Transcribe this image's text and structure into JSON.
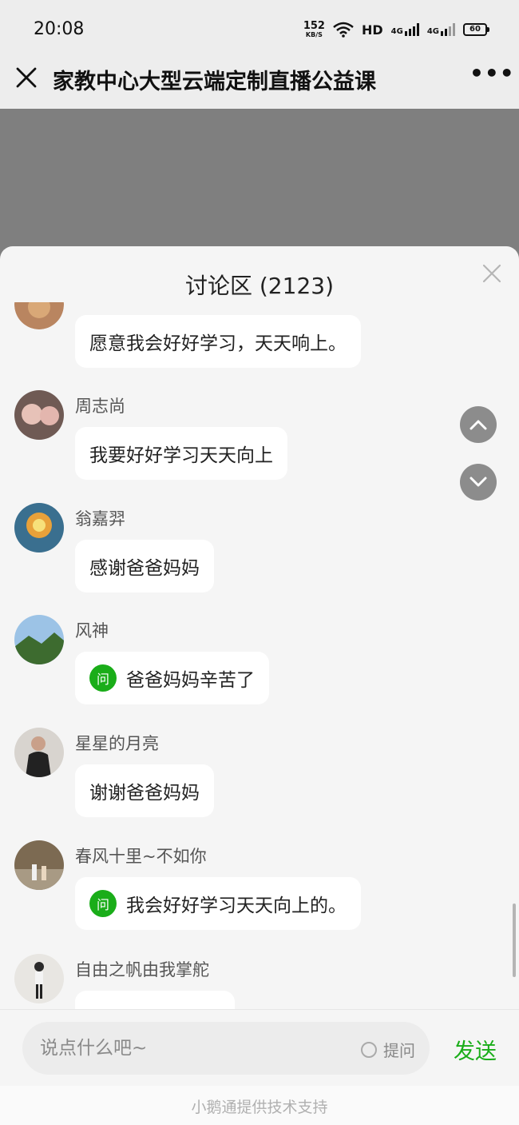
{
  "status": {
    "time": "20:08",
    "net_speed_value": "152",
    "net_speed_unit": "KB/S",
    "hd_label": "HD",
    "signal_label_1": "4G",
    "signal_label_2": "4G",
    "battery": "60"
  },
  "header": {
    "title": "家教中心大型云端定制直播公益课",
    "more_label": "•••"
  },
  "discussion": {
    "title": "讨论区 (2123)",
    "messages": [
      {
        "user": "",
        "text": "愿意我会好好学习，天天响上。",
        "is_question": false
      },
      {
        "user": "周志尚",
        "text": "我要好好学习天天向上",
        "is_question": false
      },
      {
        "user": "翁嘉羿",
        "text": "感谢爸爸妈妈",
        "is_question": false
      },
      {
        "user": "风神",
        "text": "爸爸妈妈辛苦了",
        "is_question": true
      },
      {
        "user": "星星的月亮",
        "text": "谢谢爸爸妈妈",
        "is_question": false
      },
      {
        "user": "春风十里~不如你",
        "text": "我会好好学习天天向上的。",
        "is_question": true
      },
      {
        "user": "自由之帆由我掌舵",
        "text": "",
        "is_question": false
      }
    ],
    "question_badge": "问"
  },
  "input": {
    "placeholder": "说点什么吧~",
    "ask_label": "提问",
    "send_label": "发送"
  },
  "footer": {
    "text": "小鹅通提供技术支持"
  },
  "colors": {
    "accent_green": "#1aad19",
    "video_gray": "#7f7f7f"
  }
}
